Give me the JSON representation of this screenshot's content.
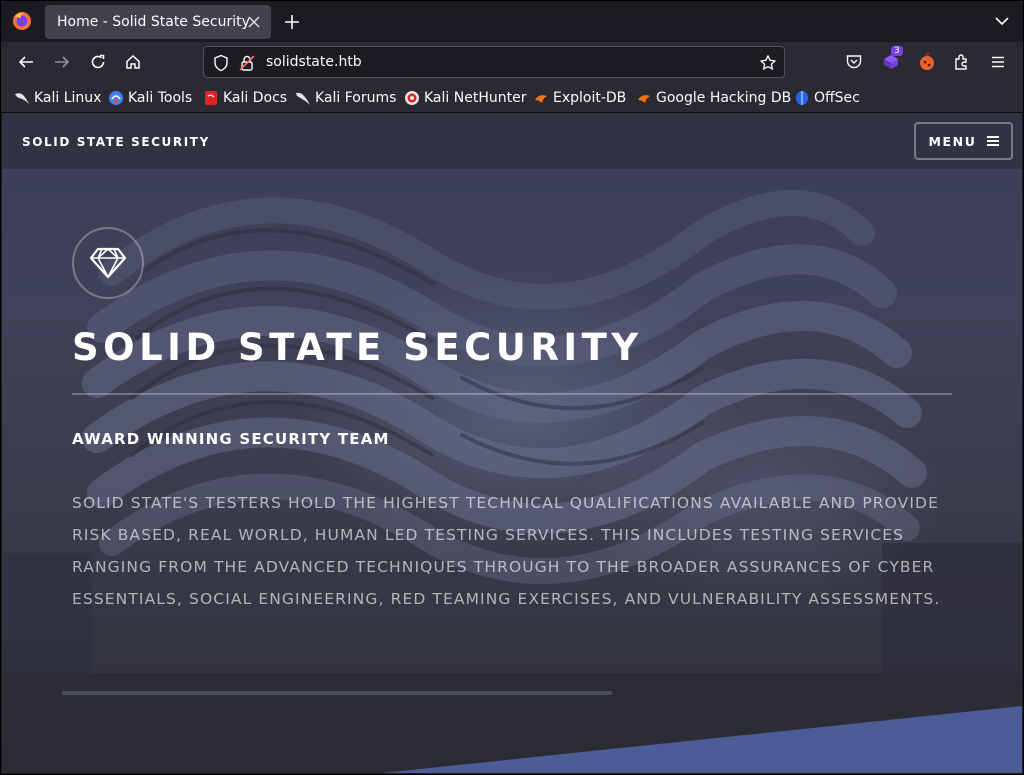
{
  "browser": {
    "tab_title": "Home - Solid State Security",
    "url": "solidstate.htb",
    "extension_badge": "3",
    "bookmarks": [
      {
        "label": "Kali Linux"
      },
      {
        "label": "Kali Tools"
      },
      {
        "label": "Kali Docs"
      },
      {
        "label": "Kali Forums"
      },
      {
        "label": "Kali NetHunter"
      },
      {
        "label": "Exploit-DB"
      },
      {
        "label": "Google Hacking DB"
      },
      {
        "label": "OffSec"
      }
    ]
  },
  "site": {
    "logo": "SOLID STATE SECURITY",
    "menu_label": "MENU",
    "hero_icon": "diamond-icon",
    "title": "SOLID STATE SECURITY",
    "subtitle": "AWARD WINNING SECURITY TEAM",
    "body": "SOLID STATE'S TESTERS HOLD THE HIGHEST TECHNICAL QUALIFICATIONS AVAILABLE AND PROVIDE RISK BASED, REAL WORLD, HUMAN LED TESTING SERVICES. THIS INCLUDES TESTING SERVICES RANGING FROM THE ADVANCED TECHNIQUES THROUGH TO THE BROADER ASSURANCES OF CYBER ESSENTIALS, SOCIAL ENGINEERING, RED TEAMING EXERCISES, AND VULNERABILITY ASSESSMENTS."
  },
  "colors": {
    "chrome_dark": "#1c1b22",
    "chrome_toolbar": "#2b2a33",
    "page_bg": "#2e3141",
    "accent_wedge": "#4c5c96"
  }
}
